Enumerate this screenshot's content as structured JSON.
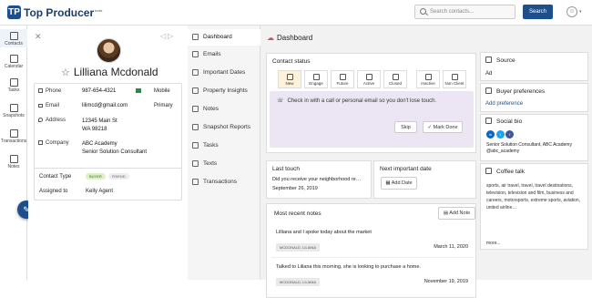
{
  "brand": {
    "name": "Top Producer",
    "sup": "beta",
    "mark": "TP"
  },
  "header": {
    "search_placeholder": "Search contacts...",
    "search_button": "Search"
  },
  "nav": {
    "items": [
      {
        "label": "Contacts"
      },
      {
        "label": "Calendar"
      },
      {
        "label": "Tasks"
      },
      {
        "label": "Snapshots"
      },
      {
        "label": "Transactions"
      },
      {
        "label": "Notes"
      }
    ]
  },
  "profile": {
    "name": "Lilliana Mcdonald",
    "contact": [
      {
        "label": "Phone",
        "value": "987-654-4321",
        "type": "Mobile"
      },
      {
        "label": "Email",
        "value": "lilimcd@gmail.com",
        "type": "Primary"
      },
      {
        "label": "Address",
        "value": "12345 Main St",
        "value2": "WA 98218",
        "type": ""
      },
      {
        "label": "Company",
        "value": "ABC Academy",
        "value2": "Senior Solution Consultant",
        "type": ""
      }
    ],
    "contact_type": {
      "label": "Contact Type",
      "chips": [
        "BUYER",
        "FRIEND"
      ]
    },
    "assigned": {
      "label": "Assigned to",
      "value": "Kelly Agent"
    }
  },
  "menu": {
    "items": [
      {
        "label": "Dashboard"
      },
      {
        "label": "Emails"
      },
      {
        "label": "Important Dates"
      },
      {
        "label": "Property Insights"
      },
      {
        "label": "Notes"
      },
      {
        "label": "Snapshot Reports"
      },
      {
        "label": "Tasks"
      },
      {
        "label": "Texts"
      },
      {
        "label": "Transactions"
      }
    ]
  },
  "dashboard": {
    "title": "Dashboard",
    "status": {
      "title": "Contact status",
      "steps": [
        "New",
        "Engage",
        "Future",
        "Active",
        "Closed",
        "Inactive",
        "Non Client"
      ],
      "prompt": "Check in with a call or personal email so you don't lose touch.",
      "skip": "Skip",
      "mark_done": "Mark Done"
    },
    "last_touch": {
      "title": "Last touch",
      "text": "Did you receive your neighborhood re…",
      "date": "September 26, 2019"
    },
    "next_date": {
      "title": "Next important date",
      "button": "Add Date"
    },
    "notes": {
      "title": "Most recent notes",
      "add": "Add Note",
      "items": [
        {
          "text": "Lilliana and I spoke today about the market",
          "tag": "MCDONALD, LILIANA",
          "date": "March 11, 2020"
        },
        {
          "text": "Talked to Liliana this morning, she is looking to purchase a home.",
          "tag": "MCDONALD, LILIANA",
          "date": "November 19, 2019"
        }
      ]
    }
  },
  "side": {
    "source": {
      "title": "Source",
      "value": "Ad"
    },
    "buyer": {
      "title": "Buyer preferences",
      "link": "Add preference"
    },
    "social": {
      "title": "Social bio",
      "bio": "Senior Solution Consultant, ABC Academy",
      "handle": "@abc_academy"
    },
    "coffee": {
      "title": "Coffee talk",
      "text": "sports, air travel, travel, travel destinations, television, television and film, business and careers, motorsports, extreme sports, aviation, united airline…",
      "more": "more..."
    }
  }
}
